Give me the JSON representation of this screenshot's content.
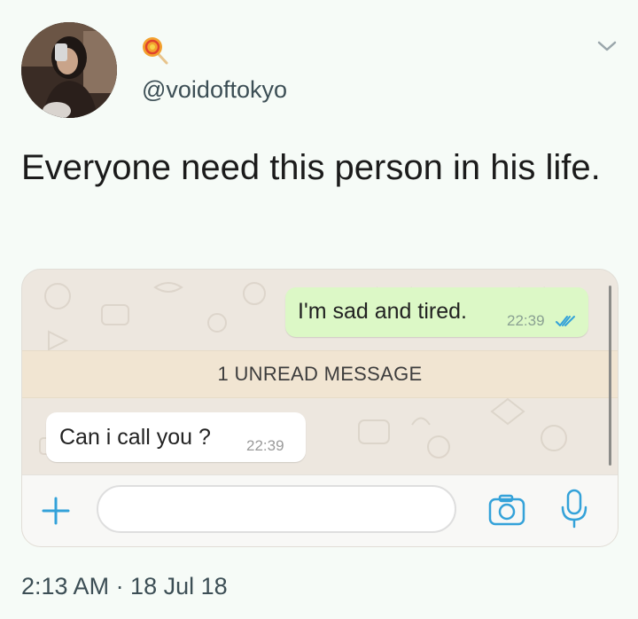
{
  "tweet": {
    "handle": "@voidoftokyo",
    "profile_emoji": "lollipop-emoji",
    "text": "Everyone need this person in his life.",
    "timestamp": "2:13 AM · 18 Jul 18"
  },
  "chat": {
    "outgoing": {
      "text": "I'm sad and tired.",
      "time": "22:39",
      "status": "read-double-check"
    },
    "unread_banner": "1 UNREAD MESSAGE",
    "incoming": {
      "text": "Can i call you ?",
      "time": "22:39"
    },
    "composer": {
      "placeholder": ""
    }
  },
  "colors": {
    "page_bg": "#f6fbf7",
    "outgoing_bubble": "#dcf8c6",
    "incoming_bubble": "#ffffff",
    "unread_bar": "#f1e5d2",
    "accent_blue": "#34a2d9",
    "handle_text": "#3c4e55"
  }
}
